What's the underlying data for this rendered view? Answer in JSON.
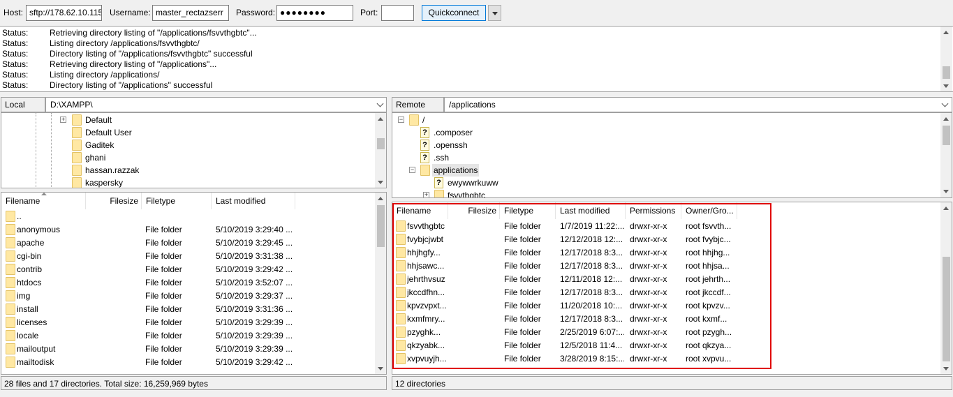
{
  "toolbar": {
    "host_label": "Host:",
    "host_value": "sftp://178.62.10.115",
    "username_label": "Username:",
    "username_value": "master_rectazserr",
    "password_label": "Password:",
    "password_value": "●●●●●●●●",
    "port_label": "Port:",
    "port_value": "",
    "quickconnect_label": "Quickconnect"
  },
  "log": [
    {
      "label": "Status:",
      "msg": "Retrieving directory listing of \"/applications/fsvvthgbtc\"..."
    },
    {
      "label": "Status:",
      "msg": "Listing directory /applications/fsvvthgbtc/"
    },
    {
      "label": "Status:",
      "msg": "Directory listing of \"/applications/fsvvthgbtc\" successful"
    },
    {
      "label": "Status:",
      "msg": "Retrieving directory listing of \"/applications\"..."
    },
    {
      "label": "Status:",
      "msg": "Listing directory /applications/"
    },
    {
      "label": "Status:",
      "msg": "Directory listing of \"/applications\" successful"
    }
  ],
  "local": {
    "site_label": "Local site:",
    "path": "D:\\XAMPP\\",
    "tree": [
      "Default",
      "Default User",
      "Gaditek",
      "ghani",
      "hassan.razzak",
      "kaspersky"
    ],
    "columns": [
      "Filename",
      "Filesize",
      "Filetype",
      "Last modified"
    ],
    "files": [
      {
        "name": "..",
        "size": "",
        "type": "",
        "modified": ""
      },
      {
        "name": "anonymous",
        "size": "",
        "type": "File folder",
        "modified": "5/10/2019 3:29:40 ..."
      },
      {
        "name": "apache",
        "size": "",
        "type": "File folder",
        "modified": "5/10/2019 3:29:45 ..."
      },
      {
        "name": "cgi-bin",
        "size": "",
        "type": "File folder",
        "modified": "5/10/2019 3:31:38 ..."
      },
      {
        "name": "contrib",
        "size": "",
        "type": "File folder",
        "modified": "5/10/2019 3:29:42 ..."
      },
      {
        "name": "htdocs",
        "size": "",
        "type": "File folder",
        "modified": "5/10/2019 3:52:07 ..."
      },
      {
        "name": "img",
        "size": "",
        "type": "File folder",
        "modified": "5/10/2019 3:29:37 ..."
      },
      {
        "name": "install",
        "size": "",
        "type": "File folder",
        "modified": "5/10/2019 3:31:36 ..."
      },
      {
        "name": "licenses",
        "size": "",
        "type": "File folder",
        "modified": "5/10/2019 3:29:39 ..."
      },
      {
        "name": "locale",
        "size": "",
        "type": "File folder",
        "modified": "5/10/2019 3:29:39 ..."
      },
      {
        "name": "mailoutput",
        "size": "",
        "type": "File folder",
        "modified": "5/10/2019 3:29:39 ..."
      },
      {
        "name": "mailtodisk",
        "size": "",
        "type": "File folder",
        "modified": "5/10/2019 3:29:42 ..."
      }
    ],
    "status": "28 files and 17 directories. Total size: 16,259,969 bytes"
  },
  "remote": {
    "site_label": "Remote site:",
    "path": "/applications",
    "tree": [
      {
        "name": "/",
        "icon": "folder"
      },
      {
        "name": ".composer",
        "icon": "question"
      },
      {
        "name": ".openssh",
        "icon": "question"
      },
      {
        "name": ".ssh",
        "icon": "question"
      },
      {
        "name": "applications",
        "icon": "folder"
      },
      {
        "name": "ewywwrkuww",
        "icon": "question"
      },
      {
        "name": "fsvvthgbtc",
        "icon": "folder"
      }
    ],
    "columns": [
      "Filename",
      "Filesize",
      "Filetype",
      "Last modified",
      "Permissions",
      "Owner/Gro..."
    ],
    "files": [
      {
        "name": "fsvvthgbtc",
        "size": "",
        "type": "File folder",
        "modified": "1/7/2019 11:22:...",
        "perms": "drwxr-xr-x",
        "owner": "root fsvvth..."
      },
      {
        "name": "fvybjcjwbt",
        "size": "",
        "type": "File folder",
        "modified": "12/12/2018 12:...",
        "perms": "drwxr-xr-x",
        "owner": "root fvybjc..."
      },
      {
        "name": "hhjhgfy...",
        "size": "",
        "type": "File folder",
        "modified": "12/17/2018 8:3...",
        "perms": "drwxr-xr-x",
        "owner": "root hhjhg..."
      },
      {
        "name": "hhjsawc...",
        "size": "",
        "type": "File folder",
        "modified": "12/17/2018 8:3...",
        "perms": "drwxr-xr-x",
        "owner": "root hhjsa..."
      },
      {
        "name": "jehrthvsuz",
        "size": "",
        "type": "File folder",
        "modified": "12/11/2018 12:...",
        "perms": "drwxr-xr-x",
        "owner": "root jehrth..."
      },
      {
        "name": "jkccdfhn...",
        "size": "",
        "type": "File folder",
        "modified": "12/17/2018 8:3...",
        "perms": "drwxr-xr-x",
        "owner": "root jkccdf..."
      },
      {
        "name": "kpvzvpxt...",
        "size": "",
        "type": "File folder",
        "modified": "11/20/2018 10:...",
        "perms": "drwxr-xr-x",
        "owner": "root kpvzv..."
      },
      {
        "name": "kxmfmry...",
        "size": "",
        "type": "File folder",
        "modified": "12/17/2018 8:3...",
        "perms": "drwxr-xr-x",
        "owner": "root kxmf..."
      },
      {
        "name": "pzyghk...",
        "size": "",
        "type": "File folder",
        "modified": "2/25/2019 6:07:...",
        "perms": "drwxr-xr-x",
        "owner": "root pzygh..."
      },
      {
        "name": "qkzyabk...",
        "size": "",
        "type": "File folder",
        "modified": "12/5/2018 11:4...",
        "perms": "drwxr-xr-x",
        "owner": "root qkzya..."
      },
      {
        "name": "xvpvuyjh...",
        "size": "",
        "type": "File folder",
        "modified": "3/28/2019 8:15:...",
        "perms": "drwxr-xr-x",
        "owner": "root xvpvu..."
      }
    ],
    "status": "12 directories"
  },
  "colors": {
    "highlight": "#e00000",
    "folder": "#ffe8a3",
    "accent": "#0078d7"
  }
}
